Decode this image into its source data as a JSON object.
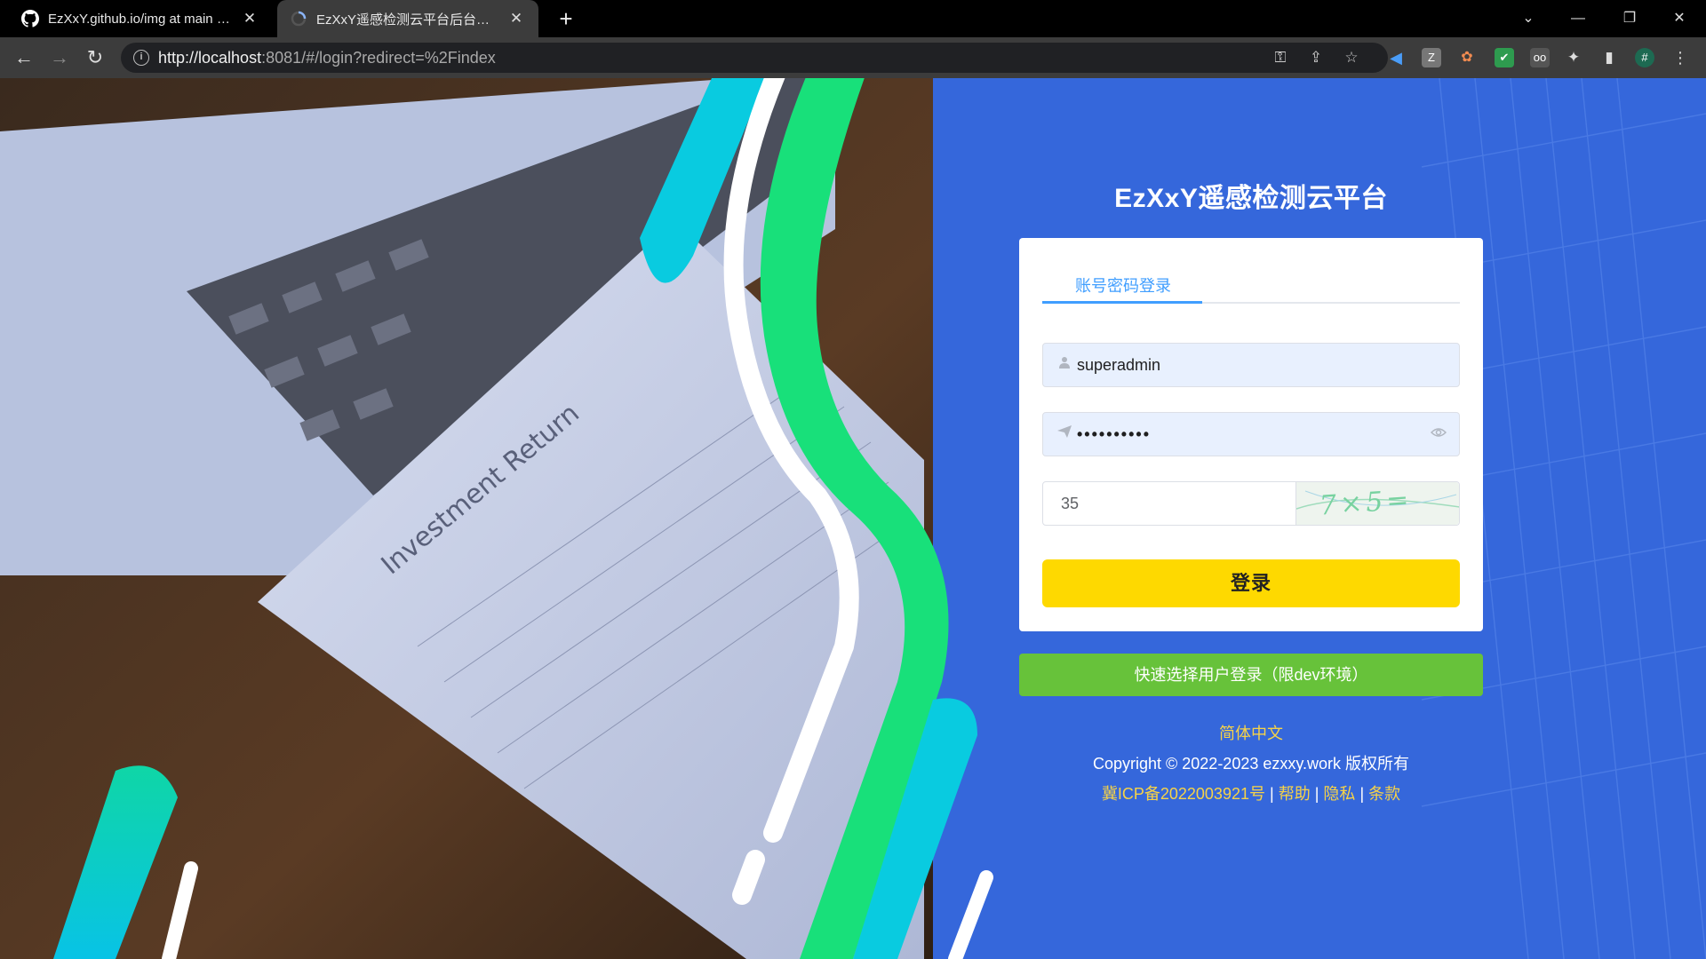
{
  "browser": {
    "tabs": [
      {
        "title": "EzXxY.github.io/img at main · EzXxY/EzXxY.github.io",
        "close": "✕"
      },
      {
        "title": "EzXxY遥感检测云平台后台管理系统",
        "close": "✕"
      }
    ],
    "new_tab": "+",
    "url_host": "http://localhost",
    "url_rest": ":8081/#/login?redirect=%2Findex",
    "window_controls": {
      "dropdown": "⌄",
      "minimize": "—",
      "restore": "❐",
      "close": "✕"
    }
  },
  "page": {
    "title": "EzXxY遥感检测云平台",
    "login_card": {
      "tab_label": "账号密码登录",
      "username": "superadmin",
      "password_mask": "••••••••••",
      "captcha_value": "35",
      "captcha_image_text": "7×5=",
      "login_button": "登录"
    },
    "quick_login_button": "快速选择用户登录（限dev环境）",
    "footer": {
      "language": "简体中文",
      "copyright": "Copyright © 2022-2023 ezxxy.work 版权所有",
      "icp": "冀ICP备2022003921号",
      "separator": "|",
      "help": "帮助",
      "privacy": "隐私",
      "terms": "条款"
    }
  },
  "colors": {
    "page_blue": "#3567db",
    "login_button": "#fed900",
    "quick_login": "#67c23a",
    "tab_active": "#409eff",
    "footer_link": "#f7d347"
  },
  "icons": [
    "github-icon",
    "loading-icon",
    "back-icon",
    "forward-icon",
    "reload-icon",
    "info-icon",
    "key-icon",
    "share-icon",
    "star-icon",
    "extensions-icon",
    "side-panel-icon",
    "menu-icon",
    "user-icon",
    "lock-icon",
    "eye-icon"
  ]
}
